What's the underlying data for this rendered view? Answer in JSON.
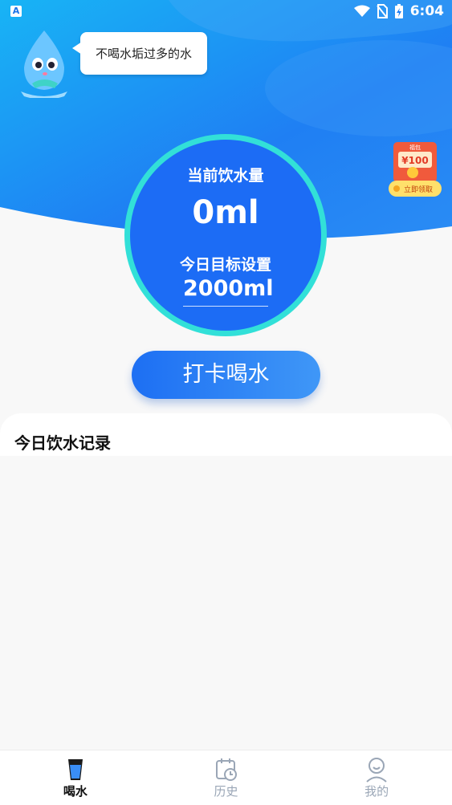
{
  "status_bar": {
    "left_icon_label": "A",
    "time": "6:04",
    "icons": [
      "wifi-icon",
      "no-sim-icon",
      "battery-charging-icon"
    ]
  },
  "mascot": {
    "bubble_text": "不喝水垢过多的水"
  },
  "promo": {
    "top_text": "福包",
    "amount": "¥100",
    "cta": "立即领取"
  },
  "water": {
    "current_label": "当前饮水量",
    "current_value": "0ml",
    "goal_label": "今日目标设置",
    "goal_value": "2000ml"
  },
  "checkin_button": "打卡喝水",
  "records": {
    "title": "今日饮水记录",
    "items": []
  },
  "nav": {
    "items": [
      {
        "label": "喝水",
        "icon": "water-cup-icon",
        "active": true
      },
      {
        "label": "历史",
        "icon": "calendar-history-icon",
        "active": false
      },
      {
        "label": "我的",
        "icon": "profile-icon",
        "active": false
      }
    ]
  },
  "colors": {
    "primary": "#1c6cf5",
    "circle_ring": "#32e0d8",
    "nav_inactive": "#9aa6b6",
    "background": "#f8f8f8"
  }
}
